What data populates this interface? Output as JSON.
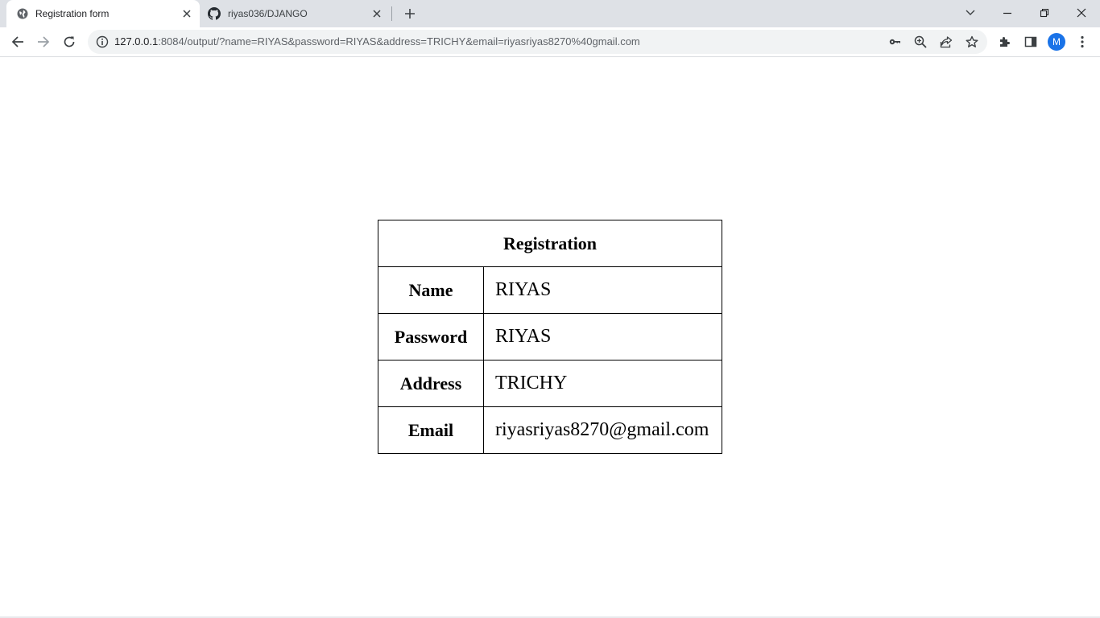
{
  "browser": {
    "tabs": [
      {
        "title": "Registration form",
        "active": true
      },
      {
        "title": "riyas036/DJANGO",
        "active": false
      }
    ],
    "address_bar": {
      "host": "127.0.0.1",
      "rest": ":8084/output/?name=RIYAS&password=RIYAS&address=TRICHY&email=riyasriyas8270%40gmail.com"
    },
    "profile_initial": "M",
    "accent_color": "#1a73e8"
  },
  "page": {
    "table_title": "Registration",
    "rows": [
      {
        "label": "Name",
        "value": "RIYAS"
      },
      {
        "label": "Password",
        "value": "RIYAS"
      },
      {
        "label": "Address",
        "value": "TRICHY"
      },
      {
        "label": "Email",
        "value": "riyasriyas8270@gmail.com"
      }
    ]
  }
}
